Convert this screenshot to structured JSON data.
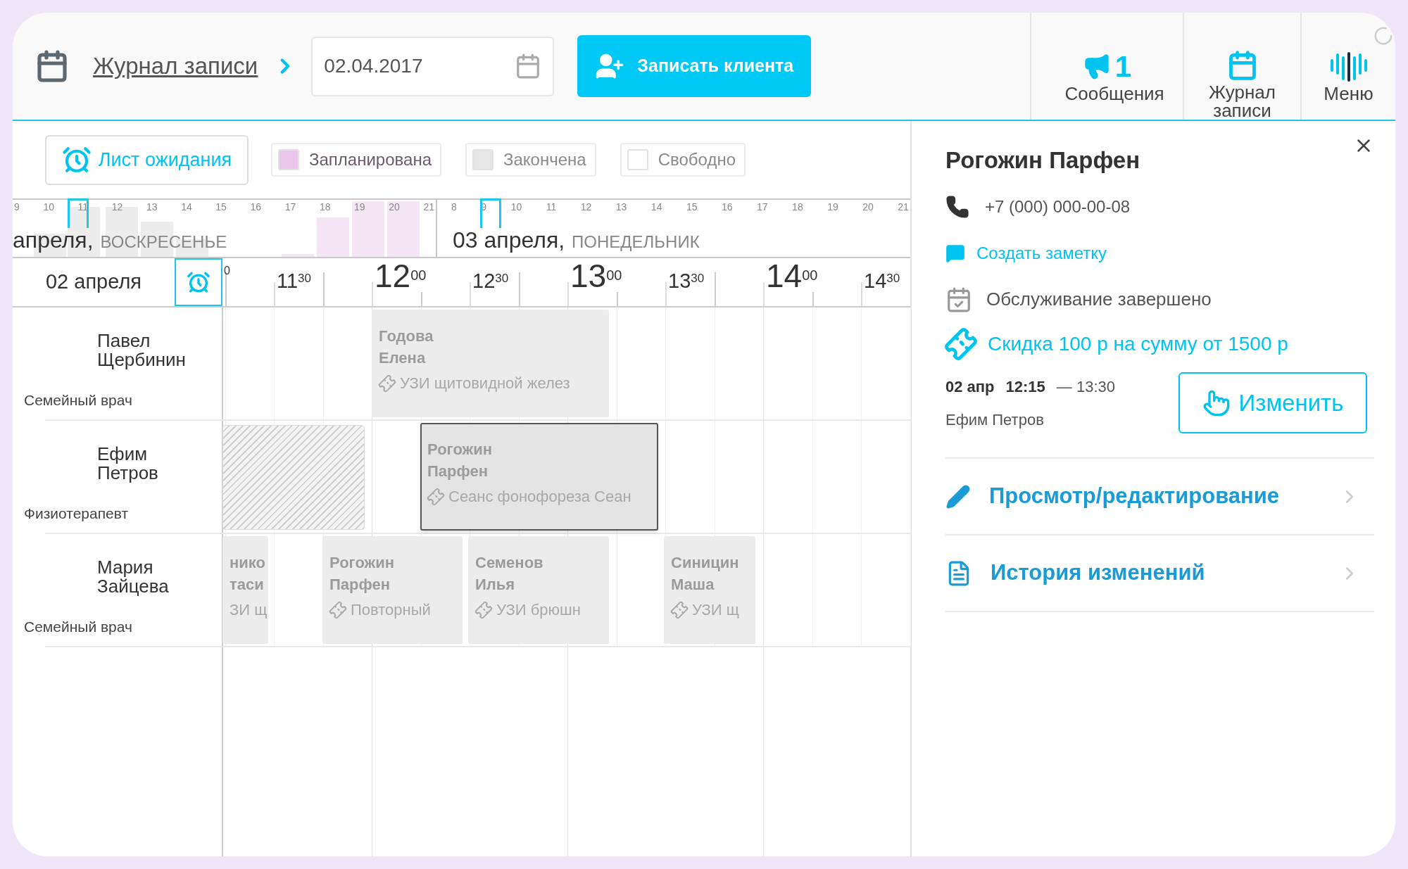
{
  "header": {
    "breadcrumb": "Журнал записи",
    "date": "02.04.2017",
    "add_button": "Записать клиента"
  },
  "nav": [
    {
      "label": "Сообщения",
      "count": "1",
      "kind": "messages"
    },
    {
      "label": "Журнал записи",
      "kind": "journal"
    },
    {
      "label": "Меню",
      "kind": "menu"
    }
  ],
  "waitlist_button": "Лист ожидания",
  "legend": [
    {
      "label": "Запланирована",
      "color": "#ebc6ec"
    },
    {
      "label": "Закончена",
      "color": "#e6e6e6"
    },
    {
      "label": "Свободно",
      "color": "#ffffff"
    }
  ],
  "overview": {
    "days": [
      {
        "date": "апреля,",
        "weekday": "ВОСКРЕСЕНЬЕ",
        "hours": [
          "9",
          "10",
          "11",
          "12",
          "13",
          "14",
          "15",
          "16",
          "17",
          "18",
          "19",
          "20",
          "21"
        ]
      },
      {
        "date": "03 апреля,",
        "weekday": "ПОНЕДЕЛЬНИК",
        "hours": [
          "8",
          "9",
          "10",
          "11",
          "12",
          "13",
          "14",
          "15",
          "16",
          "17",
          "18",
          "19",
          "20",
          "21"
        ]
      }
    ]
  },
  "schedule": {
    "date": "02 апреля",
    "time_labels": [
      {
        "kind": "cut",
        "min": "0"
      },
      {
        "kind": "half",
        "hour": "11",
        "min": "30"
      },
      {
        "kind": "hour",
        "hour": "12",
        "min": "00"
      },
      {
        "kind": "half",
        "hour": "12",
        "min": "30"
      },
      {
        "kind": "hour",
        "hour": "13",
        "min": "00"
      },
      {
        "kind": "half",
        "hour": "13",
        "min": "30"
      },
      {
        "kind": "hour",
        "hour": "14",
        "min": "00"
      },
      {
        "kind": "half",
        "hour": "14",
        "min": "30"
      }
    ],
    "staff": [
      {
        "name": "Павел Щербинин",
        "role": "Семейный врач",
        "appointments": [
          {
            "kind": "booking",
            "client": "Годова Елена",
            "service": "УЗИ щитовидной желез",
            "selected": false
          }
        ]
      },
      {
        "name": "Ефим Петров",
        "role": "Физиотерапевт",
        "appointments": [
          {
            "kind": "blocked"
          },
          {
            "kind": "booking",
            "client": "Рогожин Парфен",
            "service": "Сеанс фонофореза Сеан",
            "selected": true
          }
        ]
      },
      {
        "name": "Мария Зайцева",
        "role": "Семейный врач",
        "appointments": [
          {
            "kind": "clipped",
            "client": "нико таси",
            "service": "ЗИ щ",
            "selected": false
          },
          {
            "kind": "booking",
            "client": "Рогожин Парфен",
            "service": "Повторный",
            "selected": false
          },
          {
            "kind": "booking",
            "client": "Семенов Илья",
            "service": "УЗИ брюшн",
            "selected": false
          },
          {
            "kind": "booking",
            "client": "Синицин Маша",
            "service": "УЗИ щ",
            "selected": false
          }
        ]
      }
    ]
  },
  "detail": {
    "name": "Рогожин Парфен",
    "phone": "+7 (000) 000-00-08",
    "note_link": "Создать заметку",
    "status": "Обслуживание завершено",
    "discount": "Скидка 100 р на сумму от 1500 р",
    "date": "02 апр",
    "start": "12:15",
    "end": "— 13:30",
    "staff": "Ефим Петров",
    "edit_button": "Изменить",
    "actions": [
      {
        "label": "Просмотр/редактирование",
        "kind": "edit"
      },
      {
        "label": "История изменений",
        "kind": "history"
      }
    ]
  }
}
